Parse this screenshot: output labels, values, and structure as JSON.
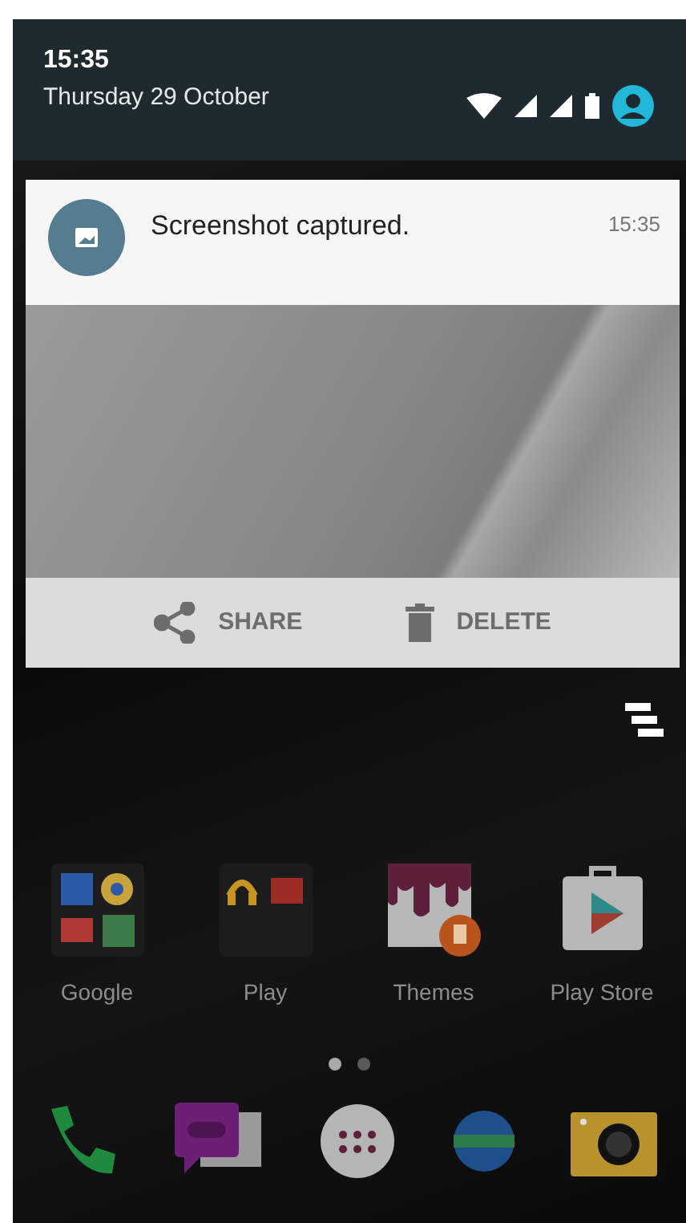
{
  "status": {
    "time": "15:35",
    "date": "Thursday 29 October"
  },
  "notification": {
    "title": "Screenshot captured.",
    "time": "15:35",
    "actions": [
      {
        "label": "SHARE",
        "kind": "share"
      },
      {
        "label": "DELETE",
        "kind": "delete"
      }
    ]
  },
  "apps": [
    {
      "label": "Google",
      "kind": "folder-google"
    },
    {
      "label": "Play",
      "kind": "folder-play"
    },
    {
      "label": "Themes",
      "kind": "themes"
    },
    {
      "label": "Play Store",
      "kind": "store"
    }
  ],
  "page_dots": [
    {
      "selected": true
    },
    {
      "selected": false
    }
  ]
}
